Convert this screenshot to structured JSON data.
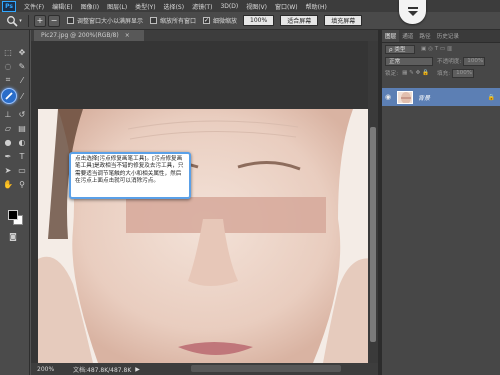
{
  "app": {
    "logo": "Ps"
  },
  "menu": [
    {
      "label": "文件",
      "mnemonic": "(F)"
    },
    {
      "label": "编辑",
      "mnemonic": "(E)"
    },
    {
      "label": "图像",
      "mnemonic": "(I)"
    },
    {
      "label": "图层",
      "mnemonic": "(L)"
    },
    {
      "label": "类型",
      "mnemonic": "(Y)"
    },
    {
      "label": "选择",
      "mnemonic": "(S)"
    },
    {
      "label": "滤镜",
      "mnemonic": "(T)"
    },
    {
      "label": "3D",
      "mnemonic": "(D)"
    },
    {
      "label": "视图",
      "mnemonic": "(V)"
    },
    {
      "label": "窗口",
      "mnemonic": "(W)"
    },
    {
      "label": "帮助",
      "mnemonic": "(H)"
    }
  ],
  "options": {
    "zoom_in": "+",
    "zoom_out": "−",
    "resize_windows_label": "调整窗口大小以满屏显示",
    "zoom_all_label": "缩放所有窗口",
    "scrubby_zoom_label": "细微缩放",
    "percent_button": "100%",
    "fit_screen_button": "适合屏幕",
    "fill_screen_button": "填充屏幕"
  },
  "document": {
    "tab_title": "Pic27.jpg @ 200%(RGB/8)",
    "tab_close": "×",
    "zoom": "200%",
    "doc_info": "文档:487.8K/487.8K"
  },
  "tooltip": {
    "text": "点击选择[污点修复画笔工具]。[污点修复画笔工具]是政相当不错的修复及去污工具，只需要适当调节笔触的大小和相关属性，然后在污点上面点击就可以消除污点。"
  },
  "panels": {
    "tabs": [
      "图层",
      "通道",
      "路径",
      "历史记录"
    ],
    "kind_label": "ρ 类型",
    "blend_mode": "正常",
    "opacity_label": "不透明度:",
    "opacity_value": "100%",
    "lock_label": "锁定:",
    "fill_label": "填充:",
    "fill_value": "100%",
    "layer_name": "背景"
  },
  "colors": {
    "accent": "#2a6dc9",
    "tooltip_border": "#5aa0e8",
    "layer_selected": "#5c7fb4"
  },
  "icons": {
    "download_badge": "download-arrow-icon",
    "zoom_tool": "magnifier-icon"
  }
}
